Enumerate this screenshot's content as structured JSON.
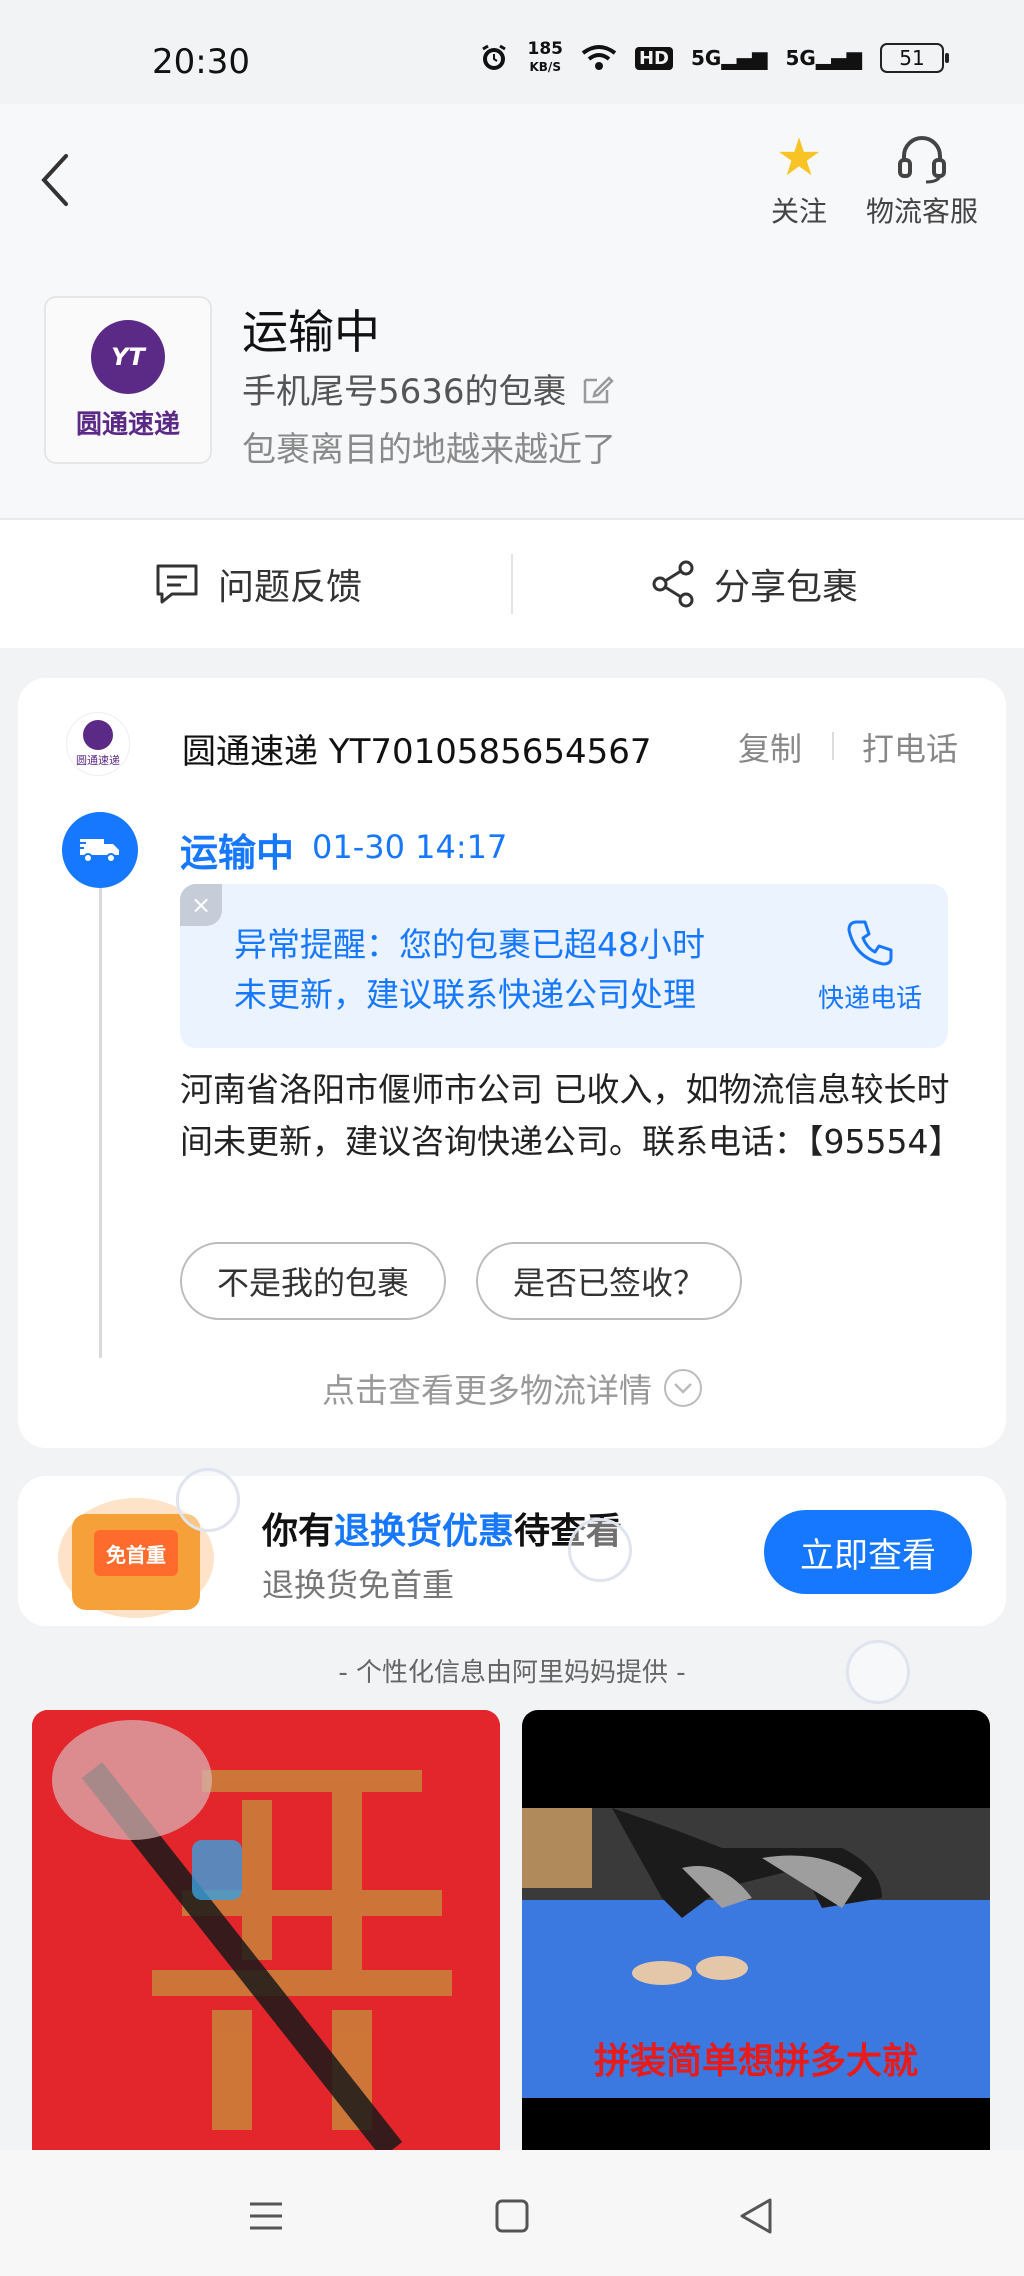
{
  "status_bar": {
    "time": "20:30",
    "speed_value": "185",
    "speed_unit": "KB/S",
    "hd": "HD",
    "signal1": "5G",
    "signal2": "5G",
    "battery": "51",
    "icons": [
      "alarm-icon",
      "wifi-icon",
      "hd-icon",
      "signal-icon",
      "signal-icon",
      "battery-icon"
    ]
  },
  "header": {
    "follow_label": "关注",
    "service_label": "物流客服",
    "status_title": "运输中",
    "phone_line": "手机尾号5636的包裹",
    "near_line": "包裹离目的地越来越近了",
    "logo_letters": "YT",
    "logo_name": "圆通速递"
  },
  "actions": {
    "feedback": "问题反馈",
    "share": "分享包裹"
  },
  "tracking": {
    "mini_logo_text": "圆通速递",
    "carrier": "圆通速递 YT7010585654567",
    "copy": "复制",
    "call": "打电话",
    "status": "运输中",
    "time": "01-30  14:17",
    "warning_close": "×",
    "warning_line1": "异常提醒：您的包裹已超48小时",
    "warning_line2": "未更新，建议联系快递公司处理",
    "warning_call_label": "快递电话",
    "detail": "河南省洛阳市偃师市公司 已收入，如物流信息较长时间未更新，建议咨询快递公司。联系电话：【95554】",
    "pill1": "不是我的包裹",
    "pill2": "是否已签收？",
    "more": "点击查看更多物流详情"
  },
  "promo": {
    "box_label": "免首重",
    "title_prefix": "你有",
    "title_highlight": "退换货优惠",
    "title_suffix": "待查看",
    "subtitle": "退换货免首重",
    "button": "立即查看"
  },
  "provided": "- 个性化信息由阿里妈妈提供 -",
  "feed": {
    "item2_caption": "拼装简单想拼多大就"
  },
  "colors": {
    "accent": "#1677ff",
    "yto_purple": "#5b2a86",
    "star": "#f7c325",
    "warning_bg": "#eaf3ff"
  }
}
